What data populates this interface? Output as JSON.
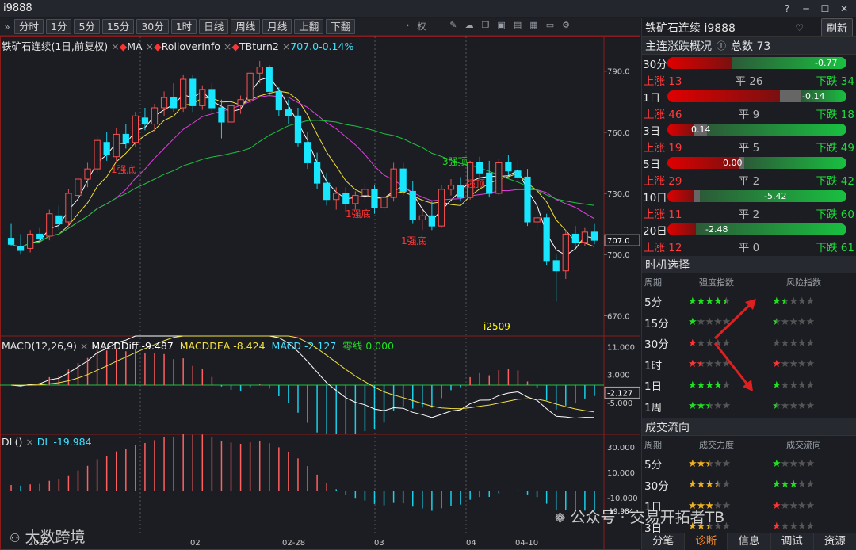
{
  "window": {
    "title": "i9888"
  },
  "toolbar": {
    "periods": [
      "分时",
      "1分",
      "5分",
      "15分",
      "30分",
      "1时",
      "日线",
      "周线",
      "月线",
      "上翻",
      "下翻"
    ]
  },
  "legends": {
    "main": {
      "symbol": "铁矿石连续(1日,前复权)",
      "ma": "MA",
      "rollover": "RolloverInfo",
      "tbturn": "TBturn2",
      "value": "707.0-0.14%"
    },
    "macd": {
      "name": "MACD(12,26,9)",
      "diff": "MACDDiff -9.487",
      "dea": "MACDDEA -8.424",
      "macd": "MACD -2.127",
      "zero": "零线 0.000"
    },
    "dl": {
      "name": "DL()",
      "dl": "DL -19.984"
    }
  },
  "axis": {
    "main_ticks": [
      "790.0",
      "760.0",
      "730.0",
      "700.0",
      "670.0"
    ],
    "last_price": "707.0",
    "macd_ticks": [
      "11.000",
      "3.000",
      "-5.000"
    ],
    "macd_last": "-2.127",
    "dl_ticks": [
      "30.000",
      "10.000",
      "-10.000"
    ],
    "dl_last": "19.984",
    "date_ticks": [
      "2025",
      "02",
      "02-28",
      "03",
      "04",
      "04-10"
    ]
  },
  "annotations": [
    {
      "text": "1强底",
      "color": "#ff3333"
    },
    {
      "text": "1强底",
      "color": "#ff3333"
    },
    {
      "text": "1强底",
      "color": "#ff3333"
    },
    {
      "text": "3强顶",
      "color": "#20e020"
    },
    {
      "text": "强顶",
      "color": "#ff3333"
    },
    {
      "text": "i2509",
      "color": "#ffff00"
    }
  ],
  "chart_data": {
    "type": "candlestick",
    "title": "铁矿石连续(1日,前复权)",
    "ylim": [
      660,
      800
    ],
    "candles": [
      {
        "o": 708,
        "h": 715,
        "l": 704,
        "c": 705
      },
      {
        "o": 704,
        "h": 710,
        "l": 700,
        "c": 702
      },
      {
        "o": 703,
        "h": 712,
        "l": 701,
        "c": 710
      },
      {
        "o": 710,
        "h": 713,
        "l": 706,
        "c": 708
      },
      {
        "o": 709,
        "h": 722,
        "l": 707,
        "c": 720
      },
      {
        "o": 719,
        "h": 724,
        "l": 712,
        "c": 715
      },
      {
        "o": 716,
        "h": 732,
        "l": 714,
        "c": 730
      },
      {
        "o": 729,
        "h": 740,
        "l": 727,
        "c": 737
      },
      {
        "o": 737,
        "h": 745,
        "l": 733,
        "c": 742
      },
      {
        "o": 742,
        "h": 758,
        "l": 740,
        "c": 756
      },
      {
        "o": 755,
        "h": 760,
        "l": 746,
        "c": 749
      },
      {
        "o": 748,
        "h": 762,
        "l": 745,
        "c": 759
      },
      {
        "o": 759,
        "h": 764,
        "l": 752,
        "c": 755
      },
      {
        "o": 755,
        "h": 770,
        "l": 753,
        "c": 768
      },
      {
        "o": 767,
        "h": 772,
        "l": 761,
        "c": 764
      },
      {
        "o": 764,
        "h": 774,
        "l": 760,
        "c": 772
      },
      {
        "o": 772,
        "h": 780,
        "l": 768,
        "c": 777
      },
      {
        "o": 777,
        "h": 784,
        "l": 770,
        "c": 772
      },
      {
        "o": 772,
        "h": 788,
        "l": 770,
        "c": 786
      },
      {
        "o": 786,
        "h": 788,
        "l": 770,
        "c": 773
      },
      {
        "o": 773,
        "h": 783,
        "l": 771,
        "c": 781
      },
      {
        "o": 781,
        "h": 784,
        "l": 770,
        "c": 772
      },
      {
        "o": 772,
        "h": 776,
        "l": 757,
        "c": 765
      },
      {
        "o": 765,
        "h": 775,
        "l": 763,
        "c": 773
      },
      {
        "o": 773,
        "h": 778,
        "l": 769,
        "c": 776
      },
      {
        "o": 776,
        "h": 790,
        "l": 774,
        "c": 789
      },
      {
        "o": 789,
        "h": 795,
        "l": 784,
        "c": 792
      },
      {
        "o": 792,
        "h": 793,
        "l": 778,
        "c": 780
      },
      {
        "o": 780,
        "h": 782,
        "l": 768,
        "c": 771
      },
      {
        "o": 771,
        "h": 776,
        "l": 764,
        "c": 768
      },
      {
        "o": 768,
        "h": 772,
        "l": 753,
        "c": 755
      },
      {
        "o": 755,
        "h": 760,
        "l": 742,
        "c": 745
      },
      {
        "o": 745,
        "h": 750,
        "l": 732,
        "c": 735
      },
      {
        "o": 735,
        "h": 740,
        "l": 724,
        "c": 727
      },
      {
        "o": 727,
        "h": 733,
        "l": 722,
        "c": 730
      },
      {
        "o": 730,
        "h": 733,
        "l": 721,
        "c": 725
      },
      {
        "o": 725,
        "h": 731,
        "l": 722,
        "c": 729
      },
      {
        "o": 729,
        "h": 735,
        "l": 726,
        "c": 732
      },
      {
        "o": 732,
        "h": 734,
        "l": 720,
        "c": 723
      },
      {
        "o": 723,
        "h": 730,
        "l": 721,
        "c": 728
      },
      {
        "o": 728,
        "h": 745,
        "l": 726,
        "c": 742
      },
      {
        "o": 742,
        "h": 745,
        "l": 729,
        "c": 731
      },
      {
        "o": 731,
        "h": 736,
        "l": 715,
        "c": 717
      },
      {
        "o": 717,
        "h": 722,
        "l": 712,
        "c": 719
      },
      {
        "o": 719,
        "h": 726,
        "l": 712,
        "c": 714
      },
      {
        "o": 714,
        "h": 734,
        "l": 713,
        "c": 732
      },
      {
        "o": 732,
        "h": 737,
        "l": 729,
        "c": 734
      },
      {
        "o": 734,
        "h": 738,
        "l": 726,
        "c": 728
      },
      {
        "o": 728,
        "h": 746,
        "l": 727,
        "c": 745
      },
      {
        "o": 745,
        "h": 748,
        "l": 737,
        "c": 740
      },
      {
        "o": 740,
        "h": 746,
        "l": 728,
        "c": 730
      },
      {
        "o": 730,
        "h": 747,
        "l": 729,
        "c": 745
      },
      {
        "o": 745,
        "h": 749,
        "l": 739,
        "c": 741
      },
      {
        "o": 741,
        "h": 747,
        "l": 736,
        "c": 738
      },
      {
        "o": 738,
        "h": 742,
        "l": 714,
        "c": 716
      },
      {
        "o": 716,
        "h": 722,
        "l": 712,
        "c": 718
      },
      {
        "o": 718,
        "h": 720,
        "l": 695,
        "c": 697
      },
      {
        "o": 697,
        "h": 700,
        "l": 677,
        "c": 692
      },
      {
        "o": 692,
        "h": 712,
        "l": 688,
        "c": 710
      },
      {
        "o": 710,
        "h": 714,
        "l": 703,
        "c": 706
      },
      {
        "o": 706,
        "h": 713,
        "l": 704,
        "c": 711
      },
      {
        "o": 711,
        "h": 715,
        "l": 705,
        "c": 707
      }
    ],
    "ma_series": [
      {
        "name": "MA5",
        "color": "#ffffff"
      },
      {
        "name": "MA10",
        "color": "#f0e040"
      },
      {
        "name": "MA20",
        "color": "#e040e0"
      },
      {
        "name": "MA60",
        "color": "#20c040"
      }
    ],
    "macd": {
      "diff_last": -9.487,
      "dea_last": -8.424,
      "macd_last": -2.127,
      "ylim": [
        -14,
        14
      ]
    },
    "dl": {
      "last": -19.984,
      "ylim": [
        -40,
        40
      ]
    }
  },
  "right_panel": {
    "title": "铁矿石连续 i9888",
    "refresh": "刷新",
    "overview": {
      "title": "主连涨跌概况",
      "total": "总数 73",
      "rows": [
        {
          "period": "30分",
          "value": "-0.77",
          "up": "上涨 13",
          "flat": "平 26",
          "down": "下跌 34",
          "red": 0.36,
          "grey": 0.0,
          "vpos": "right"
        },
        {
          "period": "1日",
          "value": "-0.14",
          "up": "上涨 46",
          "flat": "平 9",
          "down": "下跌 18",
          "red": 0.63,
          "grey": 0.12,
          "vpos": "mid"
        },
        {
          "period": "3日",
          "value": "0.14",
          "up": "上涨 19",
          "flat": "平 5",
          "down": "下跌 49",
          "red": 0.15,
          "grey": 0.07,
          "vpos": "left"
        },
        {
          "period": "5日",
          "value": "0.00",
          "up": "上涨 29",
          "flat": "平 2",
          "down": "下跌 42",
          "red": 0.4,
          "grey": 0.03,
          "vpos": "left2"
        },
        {
          "period": "10日",
          "value": "-5.42",
          "up": "上涨 11",
          "flat": "平 2",
          "down": "下跌 60",
          "red": 0.15,
          "grey": 0.03,
          "vpos": "mid2"
        },
        {
          "period": "20日",
          "value": "-2.48",
          "up": "上涨 12",
          "flat": "平 0",
          "down": "下跌 61",
          "red": 0.16,
          "grey": 0.0,
          "vpos": "left3"
        }
      ]
    },
    "timing": {
      "title": "时机选择",
      "headers": [
        "周期",
        "强度指数",
        "风险指数"
      ],
      "rows": [
        {
          "period": "5分",
          "s": 4.5,
          "sc": "#20e020",
          "r": 1.5,
          "rc": "#20e020"
        },
        {
          "period": "15分",
          "s": 1,
          "sc": "#20e020",
          "r": 0.5,
          "rc": "#20e020"
        },
        {
          "period": "30分",
          "s": 1,
          "sc": "#ff3333",
          "r": 0,
          "rc": "#20e020"
        },
        {
          "period": "1时",
          "s": 1.5,
          "sc": "#ff3333",
          "r": 1,
          "rc": "#ff3333"
        },
        {
          "period": "1日",
          "s": 4,
          "sc": "#20e020",
          "r": 1,
          "rc": "#20e020"
        },
        {
          "period": "1周",
          "s": 2.5,
          "sc": "#20e020",
          "r": 0.5,
          "rc": "#20e020"
        }
      ]
    },
    "flow": {
      "title": "成交流向",
      "headers": [
        "周期",
        "成交力度",
        "成交流向"
      ],
      "rows": [
        {
          "period": "5分",
          "s": 2.5,
          "sc": "#f0b020",
          "r": 1,
          "rc": "#20e020"
        },
        {
          "period": "30分",
          "s": 3.5,
          "sc": "#f0b020",
          "r": 3,
          "rc": "#20e020"
        },
        {
          "period": "1日",
          "s": 3,
          "sc": "#f0b020",
          "r": 1,
          "rc": "#ff3333"
        },
        {
          "period": "3日",
          "s": 2.5,
          "sc": "#f0b020",
          "r": 1,
          "rc": "#ff3333"
        }
      ]
    },
    "tabs": [
      "分笔",
      "诊断",
      "信息",
      "调试",
      "资源"
    ]
  },
  "watermark": {
    "left": "大数跨境",
    "right": "公众号 · 交易开拓者TB"
  }
}
